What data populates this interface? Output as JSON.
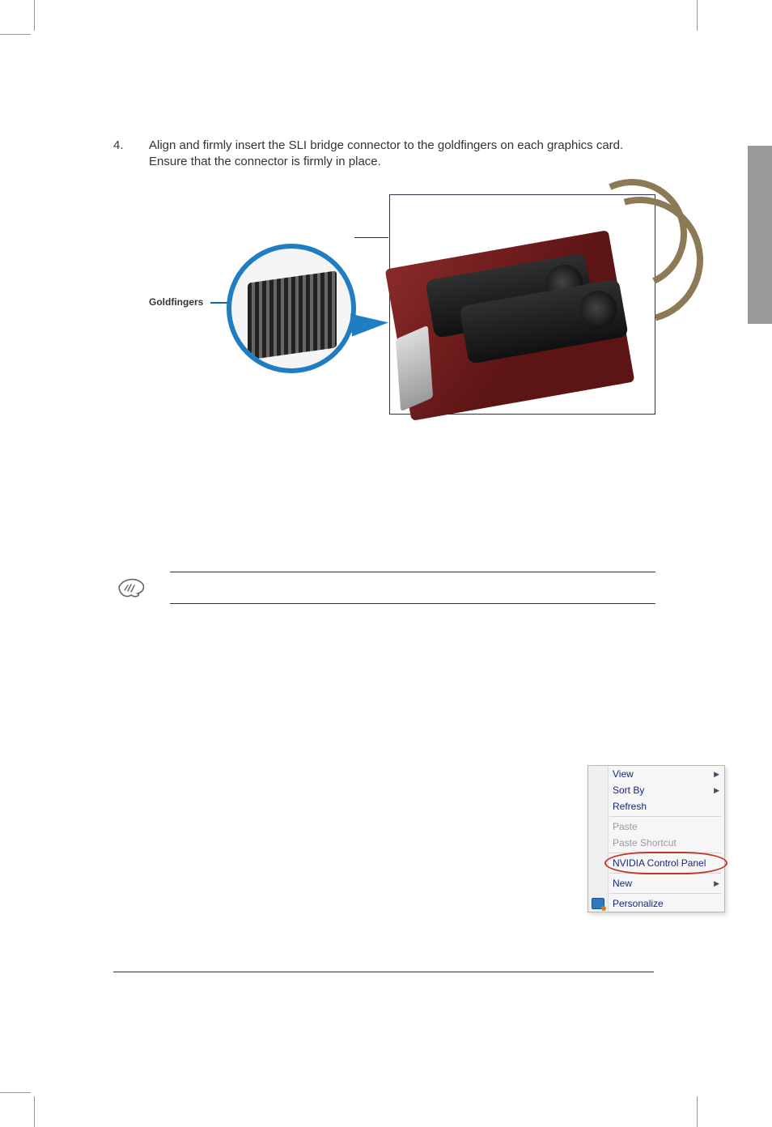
{
  "step": {
    "number": "4.",
    "text": "Align and firmly insert the SLI bridge connector to the goldfingers on each graphics card. Ensure that the connector is firmly in place."
  },
  "figure": {
    "callout_label": "Goldfingers"
  },
  "context_menu": {
    "items": [
      {
        "label": "View",
        "has_submenu": true,
        "disabled": false,
        "highlighted": false
      },
      {
        "label": "Sort By",
        "has_submenu": true,
        "disabled": false,
        "highlighted": false
      },
      {
        "label": "Refresh",
        "has_submenu": false,
        "disabled": false,
        "highlighted": false
      },
      {
        "separator": true
      },
      {
        "label": "Paste",
        "has_submenu": false,
        "disabled": true,
        "highlighted": false
      },
      {
        "label": "Paste Shortcut",
        "has_submenu": false,
        "disabled": true,
        "highlighted": false
      },
      {
        "separator": true
      },
      {
        "label": "NVIDIA Control Panel",
        "has_submenu": false,
        "disabled": false,
        "highlighted": true
      },
      {
        "separator": true
      },
      {
        "label": "New",
        "has_submenu": true,
        "disabled": false,
        "highlighted": false
      },
      {
        "separator": true
      },
      {
        "label": "Personalize",
        "has_submenu": false,
        "disabled": false,
        "highlighted": false,
        "icon": "personalize-icon"
      }
    ]
  }
}
